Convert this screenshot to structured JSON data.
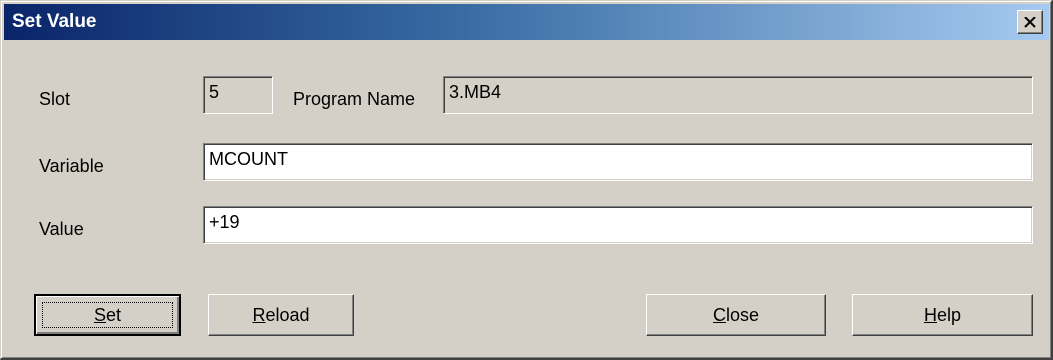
{
  "window": {
    "title": "Set Value"
  },
  "slot": {
    "label": "Slot",
    "value": "5"
  },
  "program": {
    "label": "Program Name",
    "value": "3.MB4"
  },
  "variable": {
    "label": "Variable",
    "value": "MCOUNT"
  },
  "value": {
    "label": "Value",
    "value": "+19"
  },
  "buttons": {
    "set": {
      "mnemonic": "S",
      "rest": "et"
    },
    "reload": {
      "mnemonic": "R",
      "rest": "eload"
    },
    "close": {
      "mnemonic": "C",
      "rest": "lose"
    },
    "help": {
      "mnemonic": "H",
      "rest": "elp"
    }
  },
  "icons": {
    "close": "close-icon"
  }
}
